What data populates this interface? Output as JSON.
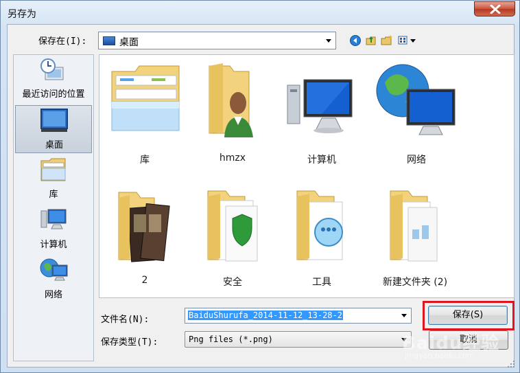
{
  "window": {
    "title": "另存为"
  },
  "header": {
    "save_in_label": "保存在(I):",
    "save_in_value": "桌面",
    "toolbar_icons": [
      "back-icon",
      "up-folder-icon",
      "new-folder-icon",
      "view-menu-icon"
    ]
  },
  "sidebar": {
    "items": [
      {
        "label": "最近访问的位置",
        "icon": "recent-places-icon",
        "selected": false
      },
      {
        "label": "桌面",
        "icon": "desktop-icon",
        "selected": true
      },
      {
        "label": "库",
        "icon": "libraries-icon",
        "selected": false
      },
      {
        "label": "计算机",
        "icon": "computer-icon",
        "selected": false
      },
      {
        "label": "网络",
        "icon": "network-icon",
        "selected": false
      }
    ]
  },
  "files": {
    "items": [
      {
        "label": "库",
        "icon": "libraries-icon"
      },
      {
        "label": "hmzx",
        "icon": "user-folder-icon"
      },
      {
        "label": "计算机",
        "icon": "computer-icon"
      },
      {
        "label": "网络",
        "icon": "network-icon"
      },
      {
        "label": "2",
        "icon": "photo-folder-icon"
      },
      {
        "label": "安全",
        "icon": "security-folder-icon"
      },
      {
        "label": "工具",
        "icon": "tools-folder-icon"
      },
      {
        "label": "新建文件夹 (2)",
        "icon": "folder-icon"
      }
    ]
  },
  "form": {
    "filename_label": "文件名(N):",
    "filename_value": "BaiduShurufa_2014-11-12_13-28-2",
    "filetype_label": "保存类型(T):",
    "filetype_value": "Png files (*.png)",
    "save_button": "保存(S)",
    "cancel_button": "取消"
  },
  "watermark": {
    "text": "Baidu经验",
    "url": "jingyan.baidu.com"
  },
  "colors": {
    "highlight": "#e0141e",
    "selection": "#3399ff",
    "folder": "#f2d27c"
  }
}
